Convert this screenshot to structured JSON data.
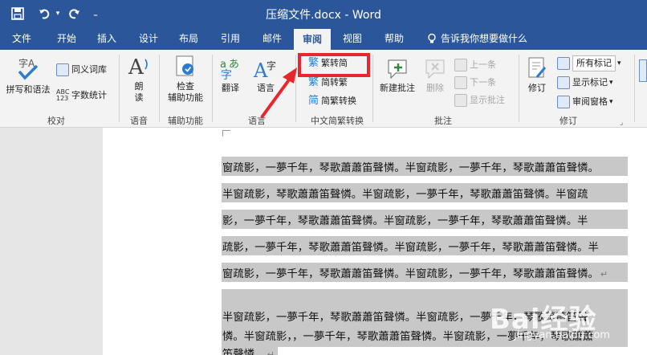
{
  "window": {
    "title": "压缩文件.docx  -  Word"
  },
  "quick_access": {
    "save_icon": "save-icon",
    "undo_icon": "undo-icon",
    "redo_icon": "redo-icon",
    "customize_icon": "customize-icon"
  },
  "tabs": [
    {
      "label": "文件"
    },
    {
      "label": "开始"
    },
    {
      "label": "插入"
    },
    {
      "label": "设计"
    },
    {
      "label": "布局"
    },
    {
      "label": "引用"
    },
    {
      "label": "邮件"
    },
    {
      "label": "审阅"
    },
    {
      "label": "视图"
    },
    {
      "label": "帮助"
    },
    {
      "label": "告诉我你想要做什么"
    }
  ],
  "ribbon": {
    "proofing": {
      "group_label": "校对",
      "spelling": "拼写和语法",
      "thesaurus": "同义词库",
      "word_count": "字数统计"
    },
    "speech": {
      "group_label": "语音",
      "read_aloud_1": "朗",
      "read_aloud_2": "读"
    },
    "accessibility": {
      "group_label": "辅助功能",
      "check_1": "检查",
      "check_2": "辅助功能"
    },
    "language": {
      "group_label": "语言",
      "translate": "翻译",
      "language": "语言"
    },
    "chinese": {
      "group_label": "中文简繁转换",
      "to_simplified": "繁转简",
      "to_traditional": "简转繁",
      "convert": "简繁转换"
    },
    "comments": {
      "group_label": "批注",
      "new_comment": "新建批注",
      "delete": "删除",
      "previous": "上一条",
      "next": "下一条",
      "show_comments": "显示批注"
    },
    "tracking": {
      "group_label": "修订",
      "track_changes": "修订",
      "all_markup": "所有标记",
      "show_markup": "显示标记",
      "review_pane": "审阅窗格"
    }
  },
  "document": {
    "lines": [
      "窗疏影，一夢千年，琴歌蕭蕭笛聲憐。半窗疏影，一夢千年，琴歌蕭蕭笛聲憐。",
      "半窗疏影，琴歌蕭蕭笛聲憐。半窗疏影，一夢千年，琴歌蕭蕭笛聲憐。半窗疏",
      "影，一夢千年，琴歌蕭蕭笛聲憐。半窗疏影，一夢千年，琴歌蕭蕭笛聲憐。半",
      "疏影，一夢千年，琴歌蕭蕭笛聲憐。半窗疏影，一夢千年，琴歌蕭蕭笛聲憐。半",
      "窗疏影，一夢千年，琴歌蕭蕭笛聲憐。半窗疏影，一夢千年，琴歌蕭蕭笛聲憐。",
      "半窗疏影，一夢千年，琴歌蕭蕭笛聲憐。半窗疏影，一夢千年，琴歌蕭蕭笛聲",
      "憐。半窗疏影，，一夢千年，琴歌蕭蕭笛聲憐。半窗疏影，一夢千年，琴歌蕭蕭",
      "笛聲憐。"
    ],
    "paragraph_mark": "↵"
  },
  "watermark": {
    "text": "Bai经验",
    "sub": "jingyan.baidu.com"
  },
  "colors": {
    "title_bar": "#2b579a",
    "highlight": "#e8262e",
    "selection": "#c8c8c8"
  }
}
